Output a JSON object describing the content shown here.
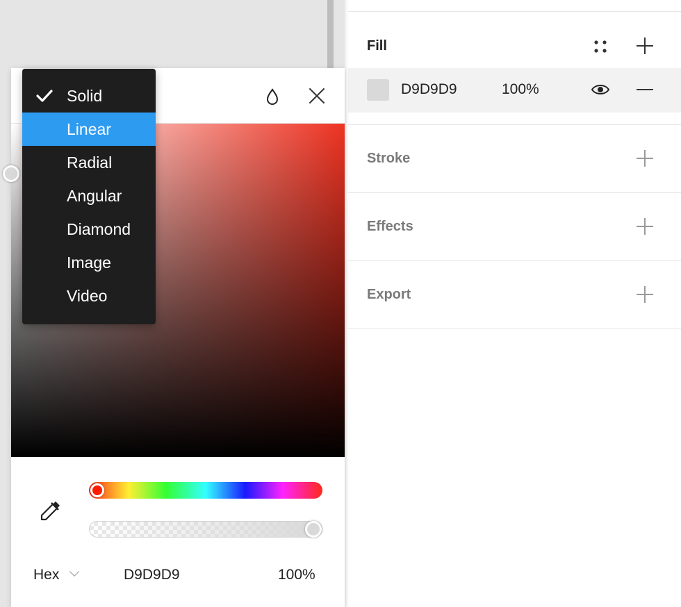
{
  "colors": {
    "panel_bg": "#ffffff",
    "canvas_bg": "#e5e5e5",
    "menu_bg": "#1e1e1e",
    "menu_highlight": "#2d9bf0",
    "fill_swatch": "#d9d9d9"
  },
  "panel": {
    "fill": {
      "title": "Fill",
      "style_icon": "four-dots-icon",
      "add_icon": "plus-icon",
      "row": {
        "hex": "D9D9D9",
        "opacity": "100%",
        "visibility_icon": "eye-icon",
        "remove_icon": "minus-icon"
      }
    },
    "stroke": {
      "title": "Stroke",
      "add_icon": "plus-icon"
    },
    "effects": {
      "title": "Effects",
      "add_icon": "plus-icon"
    },
    "export": {
      "title": "Export",
      "add_icon": "plus-icon"
    }
  },
  "picker": {
    "menu": {
      "items": [
        {
          "label": "Solid",
          "checked": true
        },
        {
          "label": "Linear",
          "highlighted": true
        },
        {
          "label": "Radial"
        },
        {
          "label": "Angular"
        },
        {
          "label": "Diamond"
        },
        {
          "label": "Image"
        },
        {
          "label": "Video"
        }
      ]
    },
    "header_icons": [
      "drop-icon",
      "close-icon"
    ],
    "hue_color": "#ff1a00",
    "alpha": 1.0,
    "color_mode": "Hex",
    "hex": "D9D9D9",
    "opacity": "100%"
  }
}
